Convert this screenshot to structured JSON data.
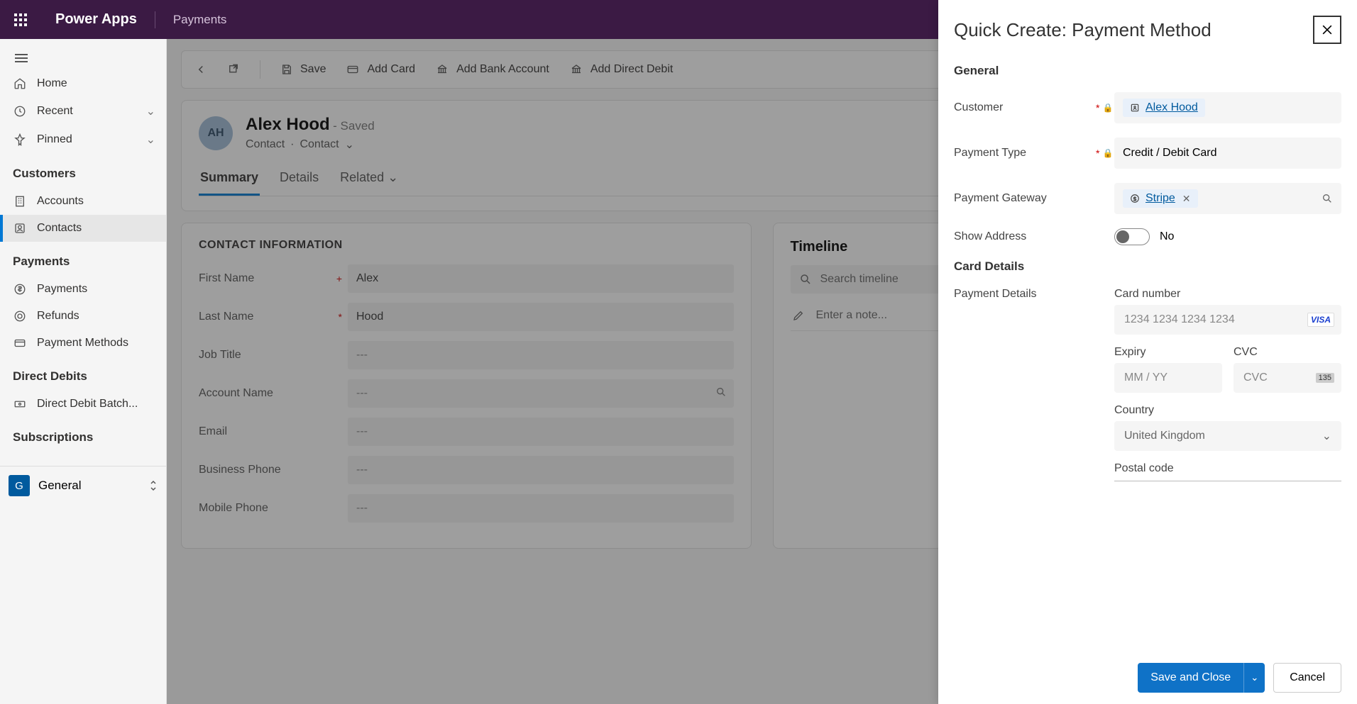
{
  "topbar": {
    "app": "Power Apps",
    "environment": "Payments"
  },
  "sidebar": {
    "home": "Home",
    "recent": "Recent",
    "pinned": "Pinned",
    "sec_customers": "Customers",
    "accounts": "Accounts",
    "contacts": "Contacts",
    "sec_payments": "Payments",
    "payments": "Payments",
    "refunds": "Refunds",
    "payment_methods": "Payment Methods",
    "sec_direct": "Direct Debits",
    "dd_batches": "Direct Debit Batch...",
    "sec_subs": "Subscriptions",
    "footer_initial": "G",
    "footer_label": "General"
  },
  "commandbar": {
    "save": "Save",
    "add_card": "Add Card",
    "add_bank": "Add Bank Account",
    "add_dd": "Add Direct Debit"
  },
  "record": {
    "avatar": "AH",
    "name": "Alex Hood",
    "saved": "- Saved",
    "entity1": "Contact",
    "entity2": "Contact",
    "tabs": {
      "summary": "Summary",
      "details": "Details",
      "related": "Related"
    }
  },
  "contactInfo": {
    "title": "CONTACT INFORMATION",
    "first_name_label": "First Name",
    "first_name": "Alex",
    "last_name_label": "Last Name",
    "last_name": "Hood",
    "job_label": "Job Title",
    "job": "---",
    "account_label": "Account Name",
    "account": "---",
    "email_label": "Email",
    "email": "---",
    "bphone_label": "Business Phone",
    "bphone": "---",
    "mphone_label": "Mobile Phone",
    "mphone": "---"
  },
  "timeline": {
    "title": "Timeline",
    "search": "Search timeline",
    "note": "Enter a note..."
  },
  "panel": {
    "title": "Quick Create: Payment Method",
    "sec_general": "General",
    "customer_label": "Customer",
    "customer_value": "Alex Hood",
    "ptype_label": "Payment Type",
    "ptype_value": "Credit / Debit Card",
    "gateway_label": "Payment Gateway",
    "gateway_value": "Stripe",
    "showaddr_label": "Show Address",
    "showaddr_value": "No",
    "sec_card": "Card Details",
    "details_label": "Payment Details",
    "cardnum_label": "Card number",
    "cardnum_ph": "1234 1234 1234 1234",
    "expiry_label": "Expiry",
    "expiry_ph": "MM / YY",
    "cvc_label": "CVC",
    "cvc_ph": "CVC",
    "cvc_badge": "135",
    "country_label": "Country",
    "country_value": "United Kingdom",
    "postal_label": "Postal code",
    "visa_brand": "VISA",
    "save_close": "Save and Close",
    "cancel": "Cancel"
  }
}
